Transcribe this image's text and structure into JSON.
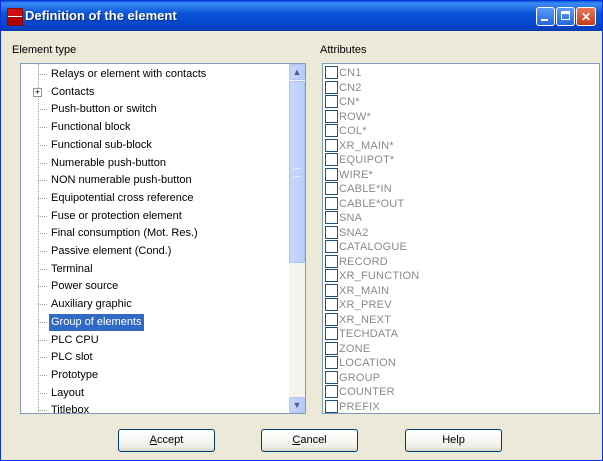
{
  "window": {
    "title": "Definition of the element",
    "minimize": "minimize",
    "maximize": "maximize",
    "close": "close"
  },
  "element_type": {
    "label": "Element type",
    "selected_index": 14,
    "items": [
      {
        "label": "Relays or element with contacts",
        "expandable": false
      },
      {
        "label": "Contacts",
        "expandable": true
      },
      {
        "label": "Push-button or switch",
        "expandable": false
      },
      {
        "label": "Functional block",
        "expandable": false
      },
      {
        "label": "Functional sub-block",
        "expandable": false
      },
      {
        "label": "Numerable push-button",
        "expandable": false
      },
      {
        "label": "NON numerable push-button",
        "expandable": false
      },
      {
        "label": "Equipotential cross reference",
        "expandable": false
      },
      {
        "label": "Fuse or protection element",
        "expandable": false
      },
      {
        "label": "Final consumption (Mot. Res.)",
        "expandable": false
      },
      {
        "label": "Passive element (Cond.)",
        "expandable": false
      },
      {
        "label": "Terminal",
        "expandable": false
      },
      {
        "label": "Power source",
        "expandable": false
      },
      {
        "label": "Auxiliary graphic",
        "expandable": false
      },
      {
        "label": "Group of elements",
        "expandable": false
      },
      {
        "label": "PLC CPU",
        "expandable": false
      },
      {
        "label": "PLC slot",
        "expandable": false
      },
      {
        "label": "Prototype",
        "expandable": false
      },
      {
        "label": "Layout",
        "expandable": false
      },
      {
        "label": "Titlebox",
        "expandable": false
      }
    ]
  },
  "attributes": {
    "label": "Attributes",
    "items": [
      "CN1",
      "CN2",
      "CN*",
      "ROW*",
      "COL*",
      "XR_MAIN*",
      "EQUIPOT*",
      "WIRE*",
      "CABLE*IN",
      "CABLE*OUT",
      "SNA",
      "SNA2",
      "CATALOGUE",
      "RECORD",
      "XR_FUNCTION",
      "XR_MAIN",
      "XR_PREV",
      "XR_NEXT",
      "TECHDATA",
      "ZONE",
      "LOCATION",
      "GROUP",
      "COUNTER",
      "PREFIX"
    ]
  },
  "buttons": {
    "accept": {
      "mnemonic": "A",
      "rest": "ccept"
    },
    "cancel": {
      "mnemonic": "C",
      "rest": "ancel"
    },
    "help": "Help"
  },
  "colors": {
    "selection": "#316ac5",
    "titlebar": "#0a55d8",
    "attribute_text": "#8a8a8a"
  }
}
